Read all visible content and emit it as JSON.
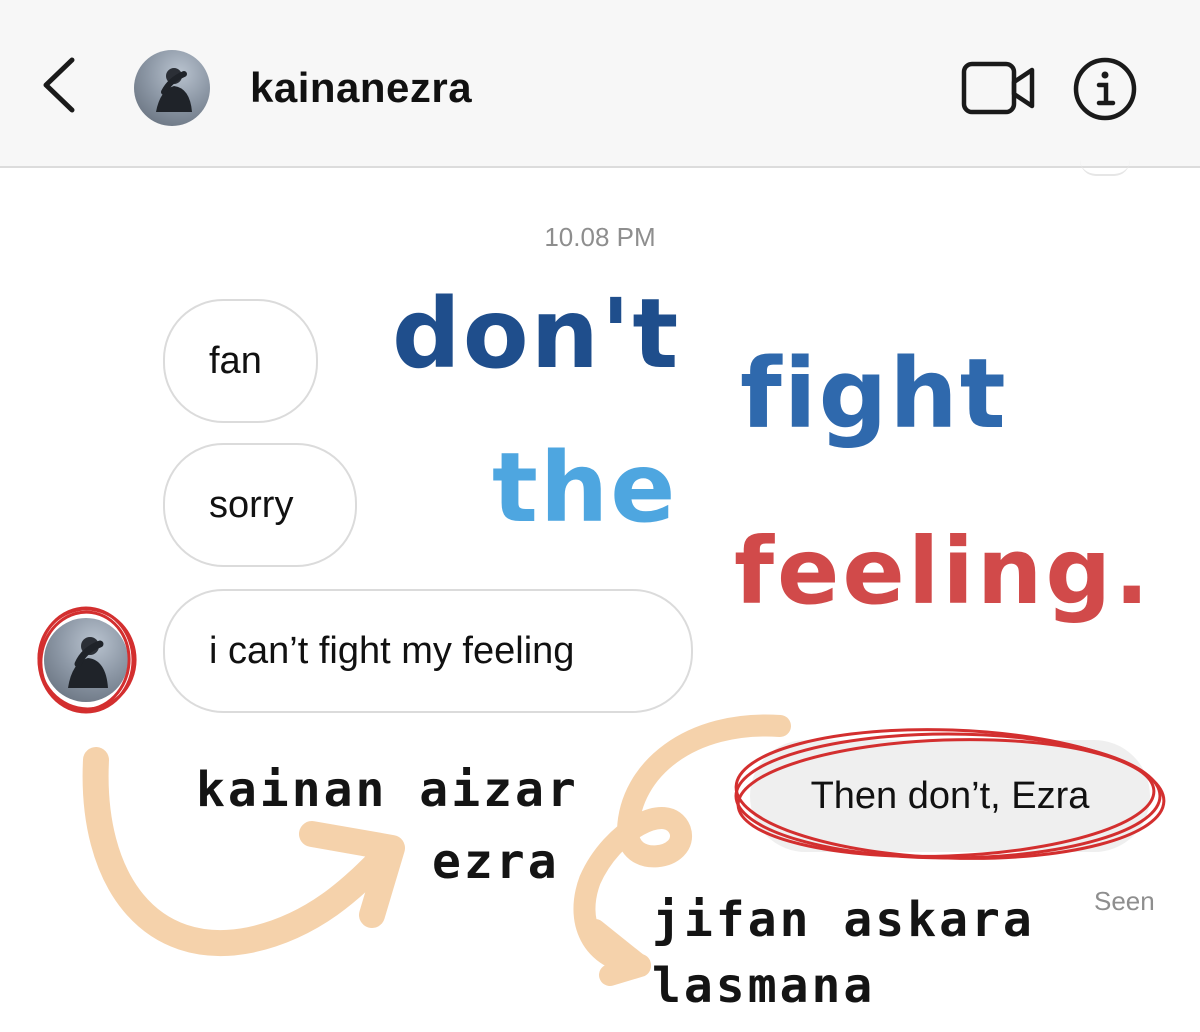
{
  "header": {
    "username": "kainanezra",
    "back_icon": "chevron-left-icon",
    "video_icon": "video-camera-icon",
    "info_icon": "info-icon"
  },
  "thread": {
    "timestamp": "10.08 PM",
    "incoming": [
      {
        "text": "fan"
      },
      {
        "text": "sorry"
      },
      {
        "text": "i can’t fight my feeling"
      }
    ],
    "outgoing": [
      {
        "text": "Then don’t, Ezra"
      }
    ],
    "seen_label": "Seen"
  },
  "overlay": {
    "words": {
      "dont": "don't",
      "fight": "fight",
      "the": "the",
      "feeling": "feeling."
    },
    "colors": {
      "dark_blue": "#1f4e8c",
      "mid_blue": "#2f69ad",
      "light_blue": "#4ea6e0",
      "red": "#d14a4a",
      "arrow_peach": "#f5d2ab",
      "circle_red": "#d32f2f"
    },
    "names": {
      "person1_line1": "kainan aizar",
      "person1_line2": "ezra",
      "person2_line1": "jifan askara",
      "person2_line2": "lasmana"
    }
  }
}
